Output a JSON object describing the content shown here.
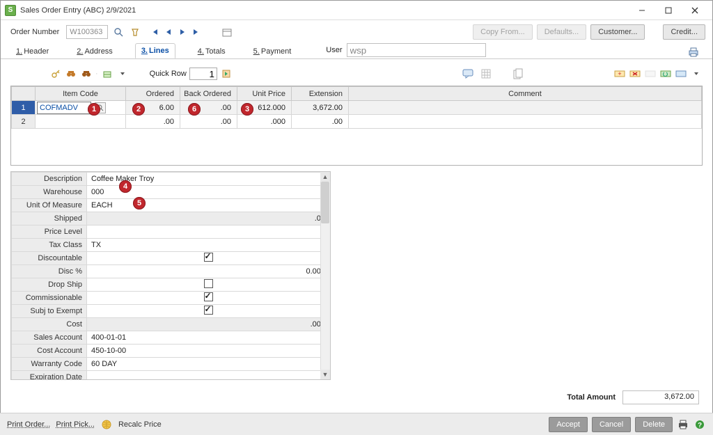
{
  "window": {
    "title": "Sales Order Entry (ABC) 2/9/2021",
    "appicon_char": "S"
  },
  "toolbar": {
    "order_number_label": "Order Number",
    "order_number_value": "W100363",
    "buttons": {
      "copy_from": "Copy From...",
      "defaults": "Defaults...",
      "customer": "Customer...",
      "credit": "Credit..."
    }
  },
  "tabs": {
    "header": "Header",
    "address": "Address",
    "lines": "Lines",
    "totals": "Totals",
    "payment": "Payment",
    "prefix": {
      "header": "1.",
      "address": "2.",
      "lines": "3.",
      "totals": "4.",
      "payment": "5."
    }
  },
  "user": {
    "label": "User",
    "value": "wsp"
  },
  "linesbar": {
    "quick_row_label": "Quick Row",
    "quick_row_value": "1"
  },
  "grid": {
    "headers": {
      "item_code": "Item Code",
      "ordered": "Ordered",
      "back_ordered": "Back Ordered",
      "unit_price": "Unit Price",
      "extension": "Extension",
      "comment": "Comment"
    },
    "rows": [
      {
        "n": "1",
        "item_code": "COFMADV",
        "ordered": "6.00",
        "back_ordered": ".00",
        "unit_price": "612.000",
        "extension": "3,672.00",
        "comment": ""
      },
      {
        "n": "2",
        "item_code": "",
        "ordered": ".00",
        "back_ordered": ".00",
        "unit_price": ".000",
        "extension": ".00",
        "comment": ""
      }
    ]
  },
  "details": {
    "description": {
      "label": "Description",
      "value": "Coffee Maker Troy"
    },
    "warehouse": {
      "label": "Warehouse",
      "value": "000"
    },
    "uom": {
      "label": "Unit Of Measure",
      "value": "EACH"
    },
    "shipped": {
      "label": "Shipped",
      "value": ".00"
    },
    "price_level": {
      "label": "Price Level",
      "value": ""
    },
    "tax_class": {
      "label": "Tax Class",
      "value": "TX"
    },
    "discountable": {
      "label": "Discountable",
      "checked": true
    },
    "disc_pct": {
      "label": "Disc %",
      "value": "0.000"
    },
    "drop_ship": {
      "label": "Drop Ship",
      "checked": false
    },
    "commissionable": {
      "label": "Commissionable",
      "checked": true
    },
    "subj_exempt": {
      "label": "Subj to Exempt",
      "checked": true
    },
    "cost": {
      "label": "Cost",
      "value": ".000"
    },
    "sales_acct": {
      "label": "Sales Account",
      "value": "400-01-01"
    },
    "cost_acct": {
      "label": "Cost Account",
      "value": "450-10-00"
    },
    "warranty": {
      "label": "Warranty Code",
      "value": "60 DAY"
    },
    "exp_date": {
      "label": "Expiration Date",
      "value": ""
    }
  },
  "totals": {
    "label": "Total Amount",
    "value": "3,672.00"
  },
  "bottom": {
    "print_order": "Print Order...",
    "print_pick": "Print Pick...",
    "recalc": "Recalc Price",
    "accept": "Accept",
    "cancel": "Cancel",
    "delete": "Delete"
  },
  "badges": {
    "b1": "1",
    "b2": "2",
    "b3": "3",
    "b4": "4",
    "b5": "5",
    "b6": "6"
  }
}
